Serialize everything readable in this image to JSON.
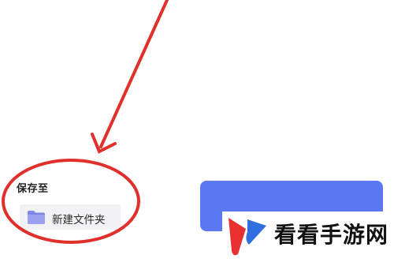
{
  "save_section": {
    "label": "保存至",
    "folder": {
      "label": "新建文件夹",
      "icon": "folder-icon"
    }
  },
  "confirm_button": {
    "label": "",
    "color": "#5a78f2"
  },
  "watermark": {
    "text": "看看手游网",
    "logo_icon": "brand-logo-icon",
    "logo_colors": [
      "#e8312f",
      "#2f6fe0"
    ]
  },
  "annotation": {
    "color": "#e0302b",
    "shapes": [
      "arrow",
      "ellipse"
    ]
  }
}
